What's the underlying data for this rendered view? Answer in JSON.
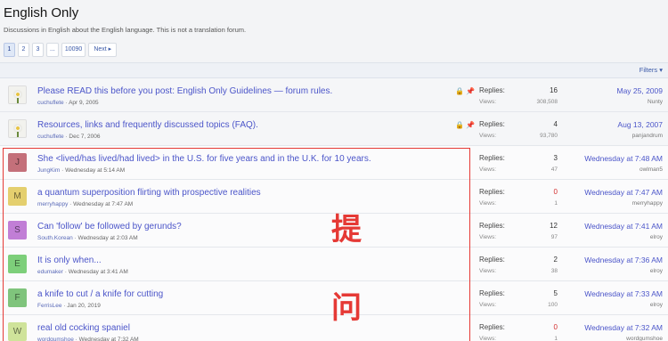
{
  "forum": {
    "title": "English Only",
    "description": "Discussions in English about the English language. This is not a translation forum."
  },
  "pagination": {
    "pages": [
      "1",
      "2",
      "3",
      "...",
      "10090"
    ],
    "current": "1",
    "next_label": "Next ▸"
  },
  "filters_label": "Filters ▾",
  "threads": [
    {
      "title": "Please READ this before you post: English Only Guidelines — forum rules.",
      "author": "cuchuflete",
      "started": "Apr 9, 2005",
      "replies": "16",
      "views": "308,508",
      "last_date": "May 25, 2009",
      "last_user": "Nunty",
      "avatar_letter": "",
      "avatar_color": "#f2f2ee",
      "sticky": true
    },
    {
      "title": "Resources, links and frequently discussed topics (FAQ).",
      "author": "cuchuflete",
      "started": "Dec 7, 2006",
      "replies": "4",
      "views": "93,780",
      "last_date": "Aug 13, 2007",
      "last_user": "panjandrum",
      "avatar_letter": "",
      "avatar_color": "#f2f2ee",
      "sticky": true
    },
    {
      "title": "She <lived/has lived/had lived> in the U.S. for five years and in the U.K. for 10 years.",
      "author": "JungKim",
      "started": "Wednesday at 5:14 AM",
      "replies": "3",
      "views": "47",
      "last_date": "Wednesday at 7:48 AM",
      "last_user": "owlman5",
      "avatar_letter": "J",
      "avatar_color": "#c4707a",
      "sticky": false
    },
    {
      "title": "a quantum superposition flirting with prospective realities",
      "author": "merryhappy",
      "started": "Wednesday at 7:47 AM",
      "replies": "0",
      "views": "1",
      "last_date": "Wednesday at 7:47 AM",
      "last_user": "merryhappy",
      "avatar_letter": "M",
      "avatar_color": "#e4cf6e",
      "sticky": false
    },
    {
      "title": "Can 'follow' be followed by gerunds?",
      "author": "South.Korean",
      "started": "Wednesday at 2:03 AM",
      "replies": "12",
      "views": "97",
      "last_date": "Wednesday at 7:41 AM",
      "last_user": "elroy",
      "avatar_letter": "S",
      "avatar_color": "#c17ed6",
      "sticky": false
    },
    {
      "title": "It is only when...",
      "author": "edumaker",
      "started": "Wednesday at 3:41 AM",
      "replies": "2",
      "views": "38",
      "last_date": "Wednesday at 7:36 AM",
      "last_user": "elroy",
      "avatar_letter": "E",
      "avatar_color": "#7dcf7a",
      "sticky": false
    },
    {
      "title": "a knife to cut / a knife for cutting",
      "author": "FerrisLee",
      "started": "Jan 20, 2019",
      "replies": "5",
      "views": "100",
      "last_date": "Wednesday at 7:33 AM",
      "last_user": "elroy",
      "avatar_letter": "F",
      "avatar_color": "#7fc47c",
      "sticky": false
    },
    {
      "title": "real old cocking spaniel",
      "author": "wordgumshoe",
      "started": "Wednesday at 7:32 AM",
      "replies": "0",
      "views": "1",
      "last_date": "Wednesday at 7:32 AM",
      "last_user": "wordgumshoe",
      "avatar_letter": "W",
      "avatar_color": "#cfe39a",
      "sticky": false
    }
  ],
  "labels": {
    "replies": "Replies:",
    "views": "Views:",
    "meta_sep": " · "
  },
  "annotation": {
    "char1": "提",
    "char2": "问",
    "color": "#e53935"
  }
}
